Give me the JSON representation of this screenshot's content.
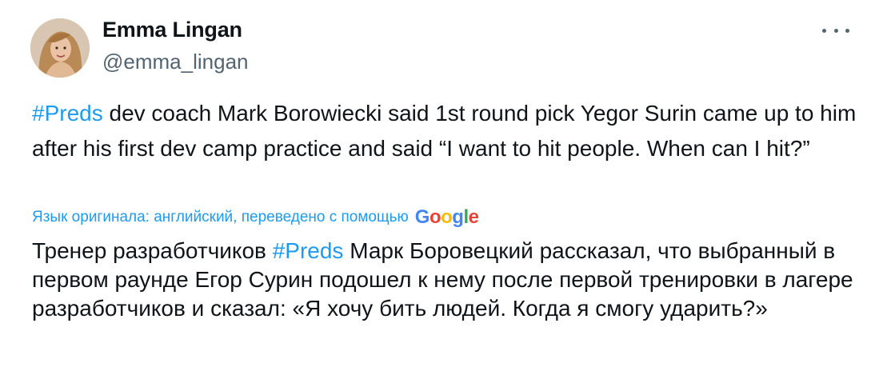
{
  "author": {
    "name": "Emma Lingan",
    "handle": "@emma_lingan"
  },
  "menu": {
    "icon": "more-horizontal-icon"
  },
  "tweet": {
    "hashtag": "#Preds",
    "text_after_hashtag": " dev coach Mark Borowiecki said 1st round pick Yegor Surin came up to him after his first dev camp practice and said “I want to hit people. When can I hit?”"
  },
  "translation": {
    "note": "Язык оригинала: английский, переведено с помощью",
    "provider": "Google",
    "text_before_hashtag": "Тренер разработчиков ",
    "hashtag": "#Preds",
    "text_after_hashtag": " Марк Боровецкий рассказал, что выбранный в первом раунде Егор Сурин подошел к нему после первой тренировки в лагере разработчиков и сказал: «Я хочу бить людей. Когда я смогу ударить?»"
  },
  "colors": {
    "link": "#1d9bf0",
    "text": "#0f1419",
    "secondary": "#536471"
  }
}
